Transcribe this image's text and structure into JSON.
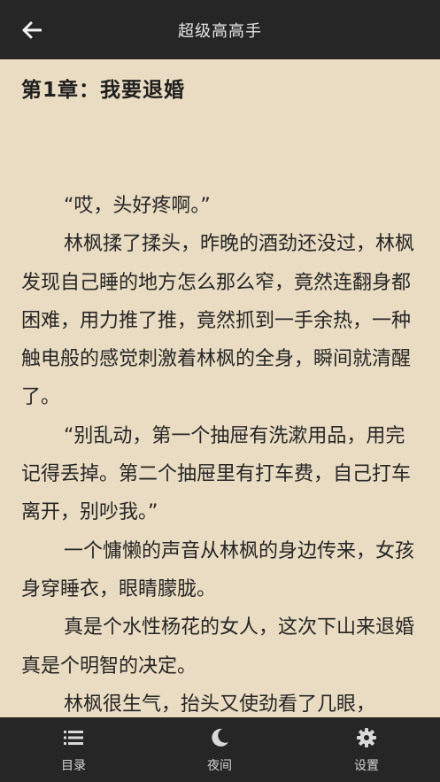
{
  "header": {
    "title": "超级高高手",
    "back_icon": "arrow-left-icon"
  },
  "chapter": {
    "title": "第1章：我要退婚"
  },
  "content": {
    "paragraphs": [
      "“哎，头好疼啊。”",
      "林枫揉了揉头，昨晚的酒劲还没过，林枫发现自己睡的地方怎么那么窄，竟然连翻身都困难，用力推了推，竟然抓到一手余热，一种触电般的感觉刺激着林枫的全身，瞬间就清醒了。",
      "“别乱动，第一个抽屉有洗漱用品，用完记得丢掉。第二个抽屉里有打车费，自己打车离开，别吵我。”",
      "一个慵懒的声音从林枫的身边传来，女孩身穿睡衣，眼睛朦胧。",
      "真是个水性杨花的女人，这次下山来退婚真是个明智的决定。",
      "林枫很生气，抬头又使劲看了几眼，"
    ]
  },
  "bottom_nav": {
    "items": [
      {
        "label": "目录",
        "icon": "list-icon"
      },
      {
        "label": "夜间",
        "icon": "moon-icon"
      },
      {
        "label": "设置",
        "icon": "gear-icon"
      }
    ]
  },
  "colors": {
    "bar_background": "#262626",
    "page_background": "#e9dcc2",
    "text": "#262626"
  }
}
